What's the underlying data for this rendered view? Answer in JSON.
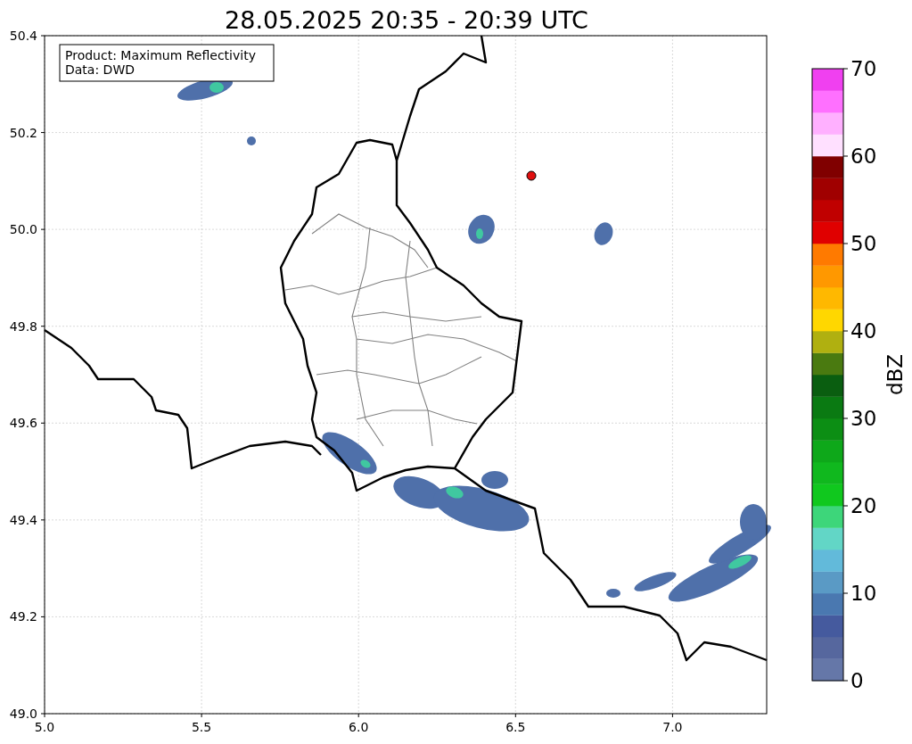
{
  "title": "28.05.2025 20:35 - 20:39 UTC",
  "info_box": {
    "lines": [
      "Product: Maximum Reflectivity",
      "Data: DWD"
    ]
  },
  "map": {
    "xticks": [
      "5.0",
      "5.5",
      "6.0",
      "6.5",
      "7.0"
    ],
    "yticks": [
      "50.4",
      "50.2",
      "50.0",
      "49.8",
      "49.6",
      "49.4",
      "49.2",
      "49.0"
    ]
  },
  "colorbar": {
    "label": "dBZ",
    "ticks": [
      "70",
      "60",
      "50",
      "40",
      "30",
      "20",
      "10",
      "0"
    ],
    "segments": [
      {
        "color": "#6577a8"
      },
      {
        "color": "#56679e"
      },
      {
        "color": "#455a9e"
      },
      {
        "color": "#4a78b0"
      },
      {
        "color": "#5a9ac5"
      },
      {
        "color": "#62bada"
      },
      {
        "color": "#62d6c6"
      },
      {
        "color": "#3dd67a"
      },
      {
        "color": "#10c81e"
      },
      {
        "color": "#10b81e"
      },
      {
        "color": "#0ea81a"
      },
      {
        "color": "#0c8e14"
      },
      {
        "color": "#0a7a12"
      },
      {
        "color": "#0a5e10"
      },
      {
        "color": "#4a7a10"
      },
      {
        "color": "#b0b010"
      },
      {
        "color": "#ffd700"
      },
      {
        "color": "#ffb800"
      },
      {
        "color": "#ff9800"
      },
      {
        "color": "#ff7a00"
      },
      {
        "color": "#e00000"
      },
      {
        "color": "#c00000"
      },
      {
        "color": "#a00000"
      },
      {
        "color": "#800000"
      },
      {
        "color": "#ffe0ff"
      },
      {
        "color": "#ffb0ff"
      },
      {
        "color": "#ff70ff"
      },
      {
        "color": "#f040f0"
      }
    ]
  }
}
